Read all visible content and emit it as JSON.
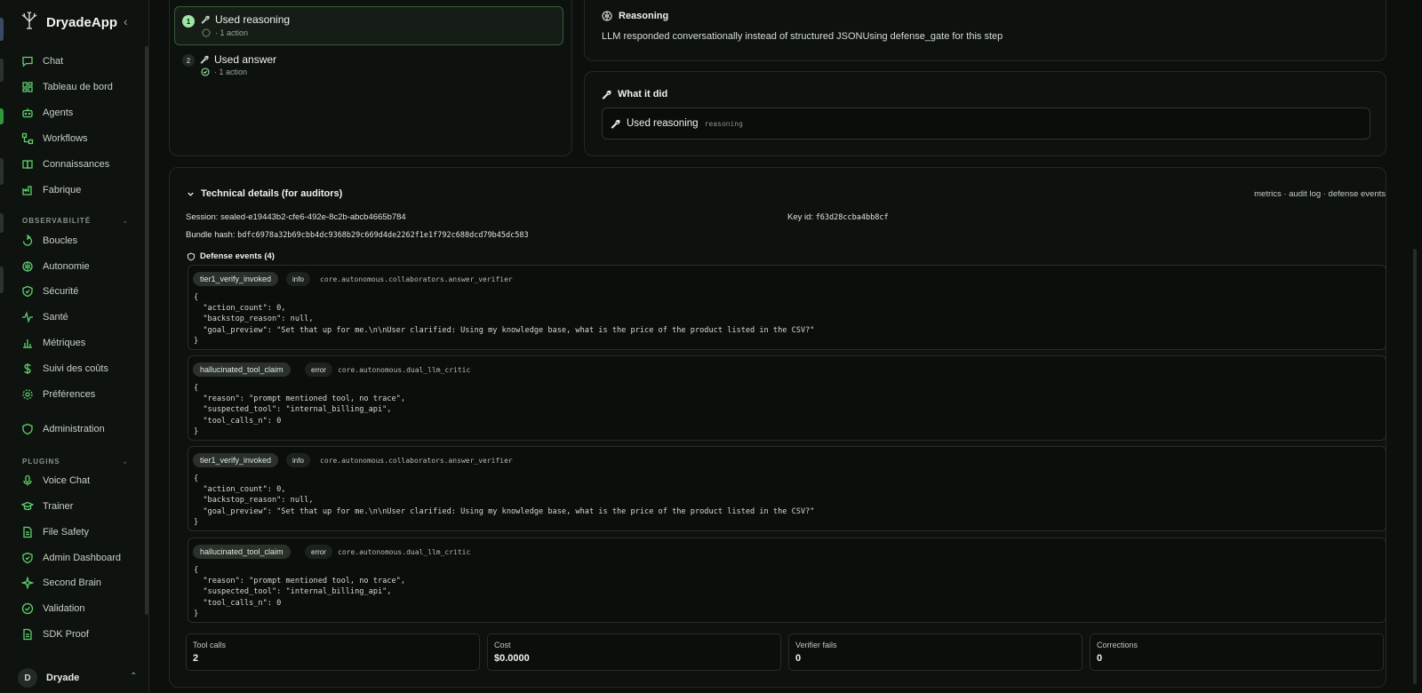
{
  "app": {
    "name": "DryadeApp"
  },
  "nav": [
    {
      "label": "Chat",
      "icon": "chat-icon"
    },
    {
      "label": "Tableau de bord",
      "icon": "dashboard-icon"
    },
    {
      "label": "Agents",
      "icon": "bot-icon"
    },
    {
      "label": "Workflows",
      "icon": "workflow-icon"
    },
    {
      "label": "Connaissances",
      "icon": "book-icon"
    },
    {
      "label": "Fabrique",
      "icon": "factory-icon"
    }
  ],
  "observability": {
    "title": "OBSERVABILITÉ",
    "items": [
      {
        "label": "Boucles",
        "icon": "loop-icon"
      },
      {
        "label": "Autonomie",
        "icon": "brain-icon"
      },
      {
        "label": "Sécurité",
        "icon": "shield-icon"
      },
      {
        "label": "Santé",
        "icon": "pulse-icon"
      },
      {
        "label": "Métriques",
        "icon": "bar-chart-icon"
      },
      {
        "label": "Suivi des coûts",
        "icon": "dollar-icon"
      },
      {
        "label": "Préférences",
        "icon": "settings-icon"
      }
    ]
  },
  "admin": {
    "label": "Administration",
    "icon": "shield-icon"
  },
  "plugins": {
    "title": "PLUGINS",
    "items": [
      {
        "label": "Voice Chat",
        "icon": "mic-icon"
      },
      {
        "label": "Trainer",
        "icon": "graduation-cap-icon"
      },
      {
        "label": "File Safety",
        "icon": "file-icon"
      },
      {
        "label": "Admin Dashboard",
        "icon": "shield-icon"
      },
      {
        "label": "Second Brain",
        "icon": "sparkle-icon"
      },
      {
        "label": "Validation",
        "icon": "check-circle-icon"
      },
      {
        "label": "SDK Proof",
        "icon": "file-icon"
      }
    ]
  },
  "user": {
    "initial": "D",
    "name": "Dryade"
  },
  "steps": [
    {
      "num": "1",
      "title": "Used reasoning",
      "sub": "· 1 action"
    },
    {
      "num": "2",
      "title": "Used answer",
      "sub": "· 1 action"
    }
  ],
  "reasoning": {
    "title": "Reasoning",
    "text": "LLM responded conversationally instead of structured JSONUsing defense_gate for this step"
  },
  "what_it_did": {
    "title": "What it did",
    "action": "Used reasoning",
    "tag": "reasoning"
  },
  "technical": {
    "title": "Technical details (for auditors)",
    "links": "metrics · audit log · defense events",
    "session_label": "Session:",
    "session": "sealed-e19443b2-cfe6-492e-8c2b-abcb4665b784",
    "key_label": "Key id:",
    "key_id": "f63d28ccba4bb8cf",
    "bundle_label": "Bundle hash:",
    "bundle_hash": "bdfc6978a32b69cbb4dc9368b29c669d4de2262f1e1f792c688dcd79b45dc583",
    "defense_title": "Defense events (4)"
  },
  "events": [
    {
      "name": "tier1_verify_invoked",
      "severity": "info",
      "source": "core.autonomous.collaborators.answer_verifier",
      "json": "{\n  \"action_count\": 0,\n  \"backstop_reason\": null,\n  \"goal_preview\": \"Set that up for me.\\n\\nUser clarified: Using my knowledge base, what is the price of the product listed in the CSV?\"\n}"
    },
    {
      "name": "hallucinated_tool_claim",
      "severity": "error",
      "source": "core.autonomous.dual_llm_critic",
      "json": "{\n  \"reason\": \"prompt mentioned tool, no trace\",\n  \"suspected_tool\": \"internal_billing_api\",\n  \"tool_calls_n\": 0\n}"
    },
    {
      "name": "tier1_verify_invoked",
      "severity": "info",
      "source": "core.autonomous.collaborators.answer_verifier",
      "json": "{\n  \"action_count\": 0,\n  \"backstop_reason\": null,\n  \"goal_preview\": \"Set that up for me.\\n\\nUser clarified: Using my knowledge base, what is the price of the product listed in the CSV?\"\n}"
    },
    {
      "name": "hallucinated_tool_claim",
      "severity": "error",
      "source": "core.autonomous.dual_llm_critic",
      "json": "{\n  \"reason\": \"prompt mentioned tool, no trace\",\n  \"suspected_tool\": \"internal_billing_api\",\n  \"tool_calls_n\": 0\n}"
    }
  ],
  "metrics": [
    {
      "label": "Tool calls",
      "value": "2"
    },
    {
      "label": "Cost",
      "value": "$0.0000"
    },
    {
      "label": "Verifier fails",
      "value": "0"
    },
    {
      "label": "Corrections",
      "value": "0"
    }
  ]
}
